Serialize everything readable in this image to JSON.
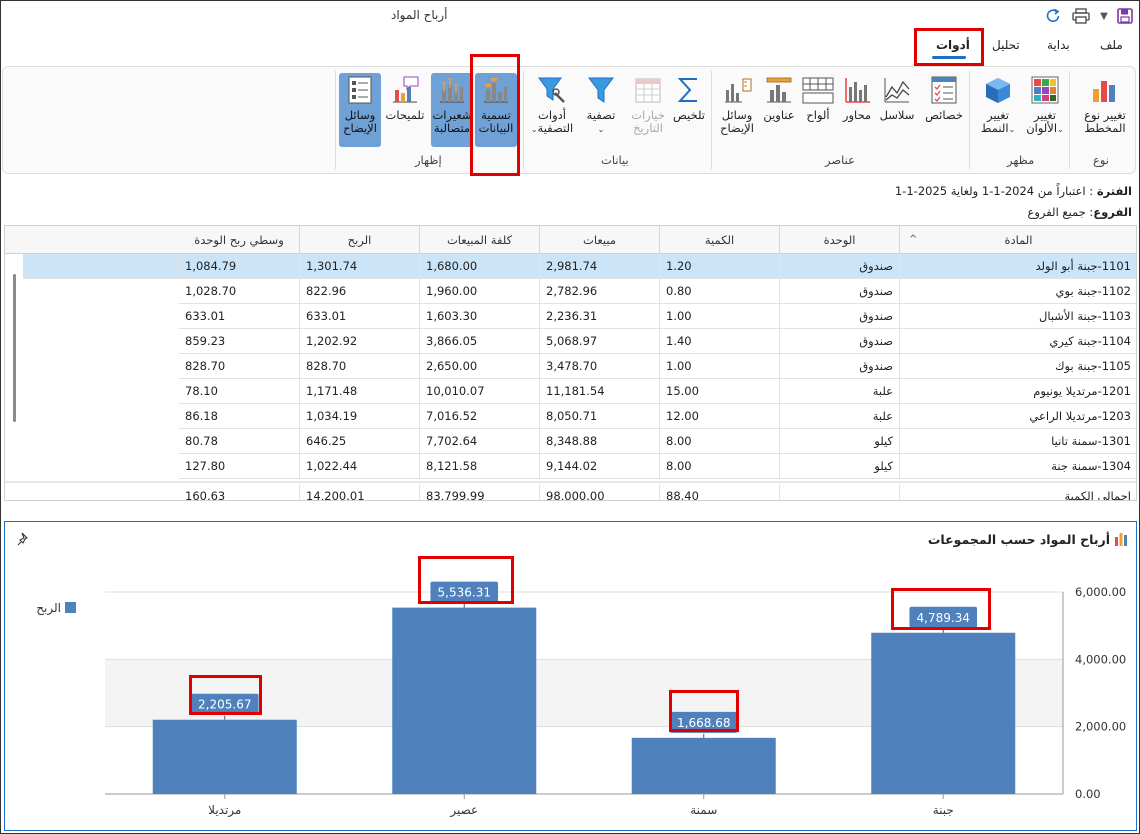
{
  "window": {
    "title": "أرباح المواد"
  },
  "tabs": [
    {
      "label": "ملف"
    },
    {
      "label": "بداية"
    },
    {
      "label": "تحليل"
    },
    {
      "label": "أدوات"
    }
  ],
  "ribbon": {
    "groups": {
      "type": "نوع",
      "appearance": "مظهر",
      "elements": "عناصر",
      "data": "بيانات",
      "show": "إظهار"
    },
    "buttons": {
      "change_type": [
        "تغيير نوع",
        "المخطط"
      ],
      "change_colors": [
        "تغيير",
        "الألوان"
      ],
      "change_style": [
        "تغيير",
        "النمط"
      ],
      "properties": "خصائص",
      "series": "سلاسل",
      "axes": "محاور",
      "panels": "ألواح",
      "titles": "عناوين",
      "legends": [
        "وسائل",
        "الإيضاح"
      ],
      "summarize": "تلخيص",
      "date_options": [
        "خيارات",
        "التاريخ"
      ],
      "filter": "تصفية",
      "filter_tools": [
        "أدوات",
        "التصفية"
      ],
      "data_labels": [
        "تسمية",
        "البيانات"
      ],
      "error_bars": [
        "شعيرات",
        "متصالبة"
      ],
      "tooltips": "تلميحات",
      "show_legends": [
        "وسائل",
        "الإيضاح"
      ]
    }
  },
  "info": {
    "period_label": "الفترة",
    "period_value": "اعتباراً من 2024-1-1 ولغاية 2025-1-1",
    "branches_label": "الفروع",
    "branches_value": "جميع الفروع"
  },
  "table": {
    "columns": [
      "المادة",
      "الوحدة",
      "الكمية",
      "مبيعات",
      "كلفة المبيعات",
      "الربح",
      "وسطي ربح الوحدة"
    ],
    "rows": [
      [
        "1101-جبنة أبو الولد",
        "صندوق",
        "1.20",
        "2,981.74",
        "1,680.00",
        "1,301.74",
        "1,084.79"
      ],
      [
        "1102-جبنة بوي",
        "صندوق",
        "0.80",
        "2,782.96",
        "1,960.00",
        "822.96",
        "1,028.70"
      ],
      [
        "1103-جبنة الأشبال",
        "صندوق",
        "1.00",
        "2,236.31",
        "1,603.30",
        "633.01",
        "633.01"
      ],
      [
        "1104-جبنة كيري",
        "صندوق",
        "1.40",
        "5,068.97",
        "3,866.05",
        "1,202.92",
        "859.23"
      ],
      [
        "1105-جبنة بوك",
        "صندوق",
        "1.00",
        "3,478.70",
        "2,650.00",
        "828.70",
        "828.70"
      ],
      [
        "1201-مرتديلا يونيوم",
        "علبة",
        "15.00",
        "11,181.54",
        "10,010.07",
        "1,171.48",
        "78.10"
      ],
      [
        "1203-مرتديلا الراعي",
        "علبة",
        "12.00",
        "8,050.71",
        "7,016.52",
        "1,034.19",
        "86.18"
      ],
      [
        "1301-سمنة تانيا",
        "كيلو",
        "8.00",
        "8,348.88",
        "7,702.64",
        "646.25",
        "80.78"
      ],
      [
        "1304-سمنة جنة",
        "كيلو",
        "8.00",
        "9,144.02",
        "8,121.58",
        "1,022.44",
        "127.80"
      ]
    ],
    "totals": [
      "اجمالي الكمية",
      "",
      "88.40",
      "98,000.00",
      "83,799.99",
      "14,200.01",
      "160.63"
    ]
  },
  "chart_panel": {
    "title": "أرباح المواد حسب المجموعات"
  },
  "chart_data": {
    "type": "bar",
    "categories": [
      "جبنة",
      "سمنة",
      "عصير",
      "مرتديلا"
    ],
    "series": [
      {
        "name": "الربح",
        "values": [
          4789.34,
          1668.68,
          5536.31,
          2205.67
        ],
        "color": "#4f81bd"
      }
    ],
    "data_labels": [
      "4,789.34",
      "1,668.68",
      "5,536.31",
      "2,205.67"
    ],
    "y_ticks": [
      "0.00",
      "2,000.00",
      "4,000.00",
      "6,000.00"
    ],
    "ylim": [
      0,
      6000
    ],
    "axis_side": "right",
    "legend_position": "top-left",
    "grid": true
  }
}
